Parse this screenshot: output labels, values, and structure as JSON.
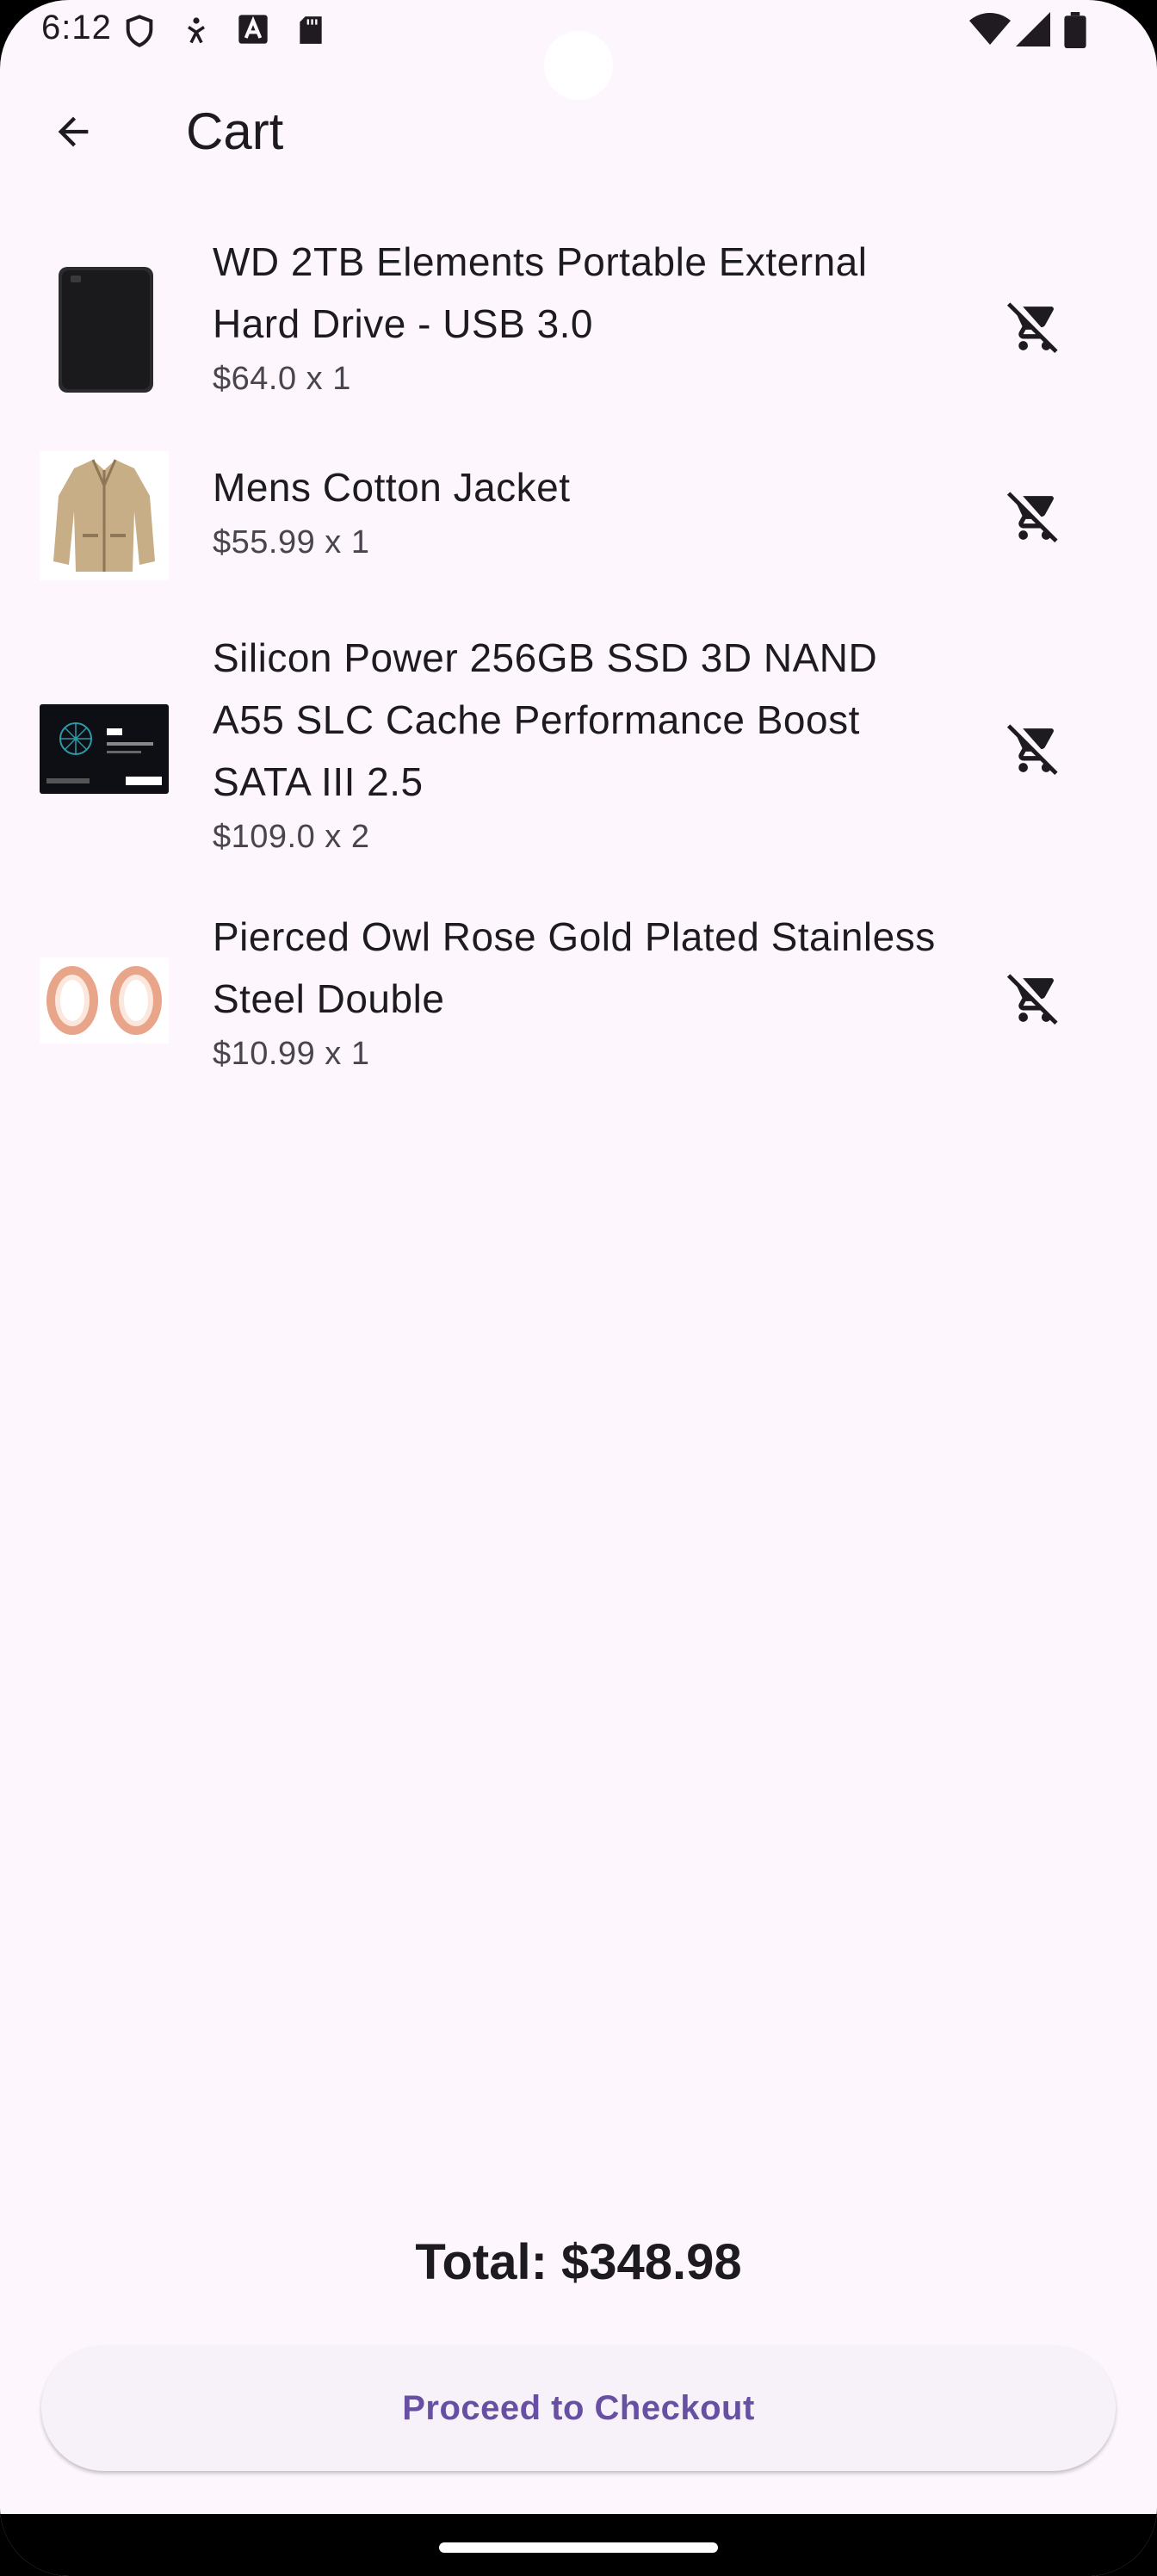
{
  "status_bar": {
    "time": "6:12",
    "icons_left": [
      "shield-icon",
      "accessibility-icon",
      "text-a-icon",
      "sd-card-icon"
    ],
    "icons_right": [
      "wifi-icon",
      "signal-icon",
      "battery-icon"
    ]
  },
  "app_bar": {
    "back_icon": "arrow-back-icon",
    "title": "Cart"
  },
  "cart": {
    "items": [
      {
        "name": "WD 2TB Elements Portable External Hard Drive - USB 3.0",
        "price": "$64.0 x 1",
        "image": "hard-drive-image"
      },
      {
        "name": "Mens Cotton Jacket",
        "price": "$55.99 x 1",
        "image": "jacket-image"
      },
      {
        "name": "Silicon Power 256GB SSD 3D NAND A55 SLC Cache Performance Boost SATA III 2.5",
        "price": "$109.0 x 2",
        "image": "ssd-image"
      },
      {
        "name": "Pierced Owl Rose Gold Plated Stainless Steel Double",
        "price": "$10.99 x 1",
        "image": "rose-gold-earrings-image"
      }
    ],
    "remove_icon": "remove-shopping-cart-icon"
  },
  "total": "Total: $348.98",
  "checkout_label": "Proceed to Checkout",
  "colors": {
    "background": "#fdf7fd",
    "primary": "#6750a4",
    "text": "#1d1b20",
    "secondary_text": "#49454f"
  }
}
